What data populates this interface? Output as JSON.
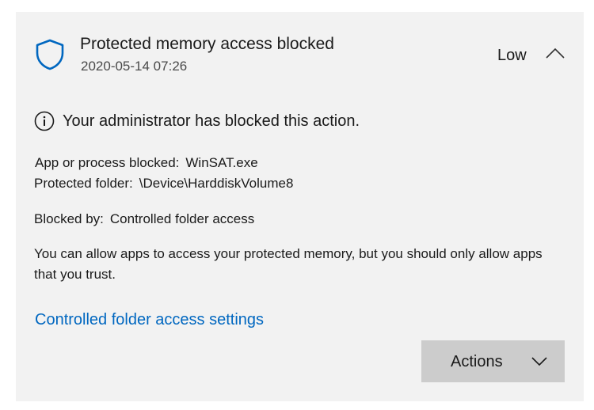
{
  "notification": {
    "title": "Protected memory access blocked",
    "timestamp": "2020-05-14 07:26",
    "severity": "Low",
    "shield_icon": "shield-icon",
    "collapse_icon": "chevron-up-icon",
    "accent_color": "#0067c0"
  },
  "info": {
    "icon": "info-icon",
    "message": "Your administrator has blocked this action."
  },
  "details": {
    "app_label": "App or process blocked:",
    "app_value": "WinSAT.exe",
    "folder_label": "Protected folder:",
    "folder_value": "\\Device\\HarddiskVolume8",
    "blocked_by_label": "Blocked by:",
    "blocked_by_value": "Controlled folder access"
  },
  "description": "You can allow apps to access your protected memory, but you should only allow apps that you trust.",
  "link": {
    "label": "Controlled folder access settings"
  },
  "actions": {
    "label": "Actions",
    "icon": "chevron-down-icon"
  }
}
